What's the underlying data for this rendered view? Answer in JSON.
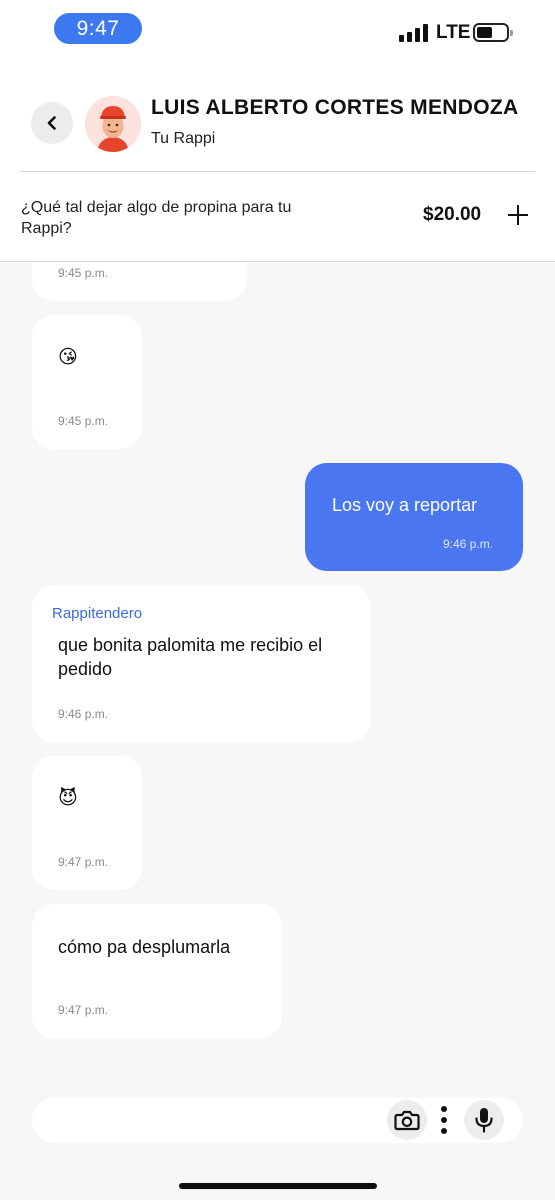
{
  "status_bar": {
    "time": "9:47",
    "network": "LTE"
  },
  "header": {
    "name": "LUIS ALBERTO CORTES MENDOZA",
    "role": "Tu Rappi",
    "tip_prompt": "¿Qué tal dejar algo de propina para tu Rappi?",
    "tip_amount": "$20.00"
  },
  "messages": [
    {
      "direction": "incoming",
      "time": "9:45 p.m."
    },
    {
      "direction": "incoming",
      "emoji": "😘",
      "time": "9:45 p.m."
    },
    {
      "direction": "outgoing",
      "text": "Los voy a reportar",
      "time": "9:46 p.m."
    },
    {
      "direction": "incoming",
      "sender": "Rappitendero",
      "text": "que bonita palomita me recibio el pedido",
      "time": "9:46 p.m."
    },
    {
      "direction": "incoming",
      "emoji": "😈",
      "time": "9:47 p.m."
    },
    {
      "direction": "incoming",
      "text": "cómo pa desplumarla",
      "time": "9:47 p.m."
    }
  ],
  "input_bar": {
    "placeholder": ""
  },
  "icons": {
    "back": "chevron-left-icon",
    "add_tip": "plus-icon",
    "camera": "camera-icon",
    "more": "more-vertical-icon",
    "mic": "microphone-icon"
  },
  "colors": {
    "accent": "#4a77f1",
    "time_pill": "#3c78f0",
    "sender_label": "#3c6ae0",
    "chat_background": "#f7f7f7"
  }
}
